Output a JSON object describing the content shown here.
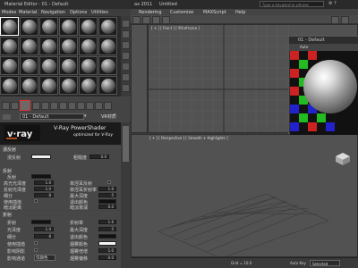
{
  "app": {
    "title_left": "ax 2011",
    "title_mid": "Untitled",
    "search_placeholder": "Type a keyword or phrase",
    "menu": [
      "Rendering",
      "Customize",
      "MAXScript",
      "Help"
    ]
  },
  "material_editor": {
    "title": "Material Editor - 01 - Default",
    "menu": [
      "Modes",
      "Material",
      "Navigation",
      "Options",
      "Utilities"
    ],
    "material_name": "01 - Default",
    "material_type": "VR材质",
    "vray_banner": {
      "logo": "v·ray",
      "title": "V-Ray PowerShader",
      "subtitle": "optimized for V-Ray"
    },
    "diffuse": {
      "header": "漫反射",
      "label": "漫反射",
      "roughness_label": "粗糙度",
      "roughness": "0.0"
    },
    "reflection": {
      "header": "反射",
      "reflect_label": "反射",
      "rows": [
        {
          "left": "高光光泽度",
          "lval": "1.0",
          "right": "菲涅耳反射",
          "rval": ""
        },
        {
          "left": "反射光泽度",
          "lval": "1.0",
          "right": "菲涅耳折射率",
          "rval": "1.6"
        },
        {
          "left": "细分",
          "lval": "8",
          "right": "最大深度",
          "rval": "5"
        },
        {
          "left": "使用插值",
          "lval": "",
          "right": "退出颜色",
          "rval": ""
        },
        {
          "left": "暗淡距离",
          "lval": "",
          "right": "暗淡衰减",
          "rval": "0.0"
        }
      ]
    },
    "refraction": {
      "header": "折射",
      "rows": [
        {
          "left": "折射",
          "lval": "",
          "right": "折射率",
          "rval": "1.6"
        },
        {
          "left": "光泽度",
          "lval": "1.0",
          "right": "最大深度",
          "rval": "5"
        },
        {
          "left": "细分",
          "lval": "8",
          "right": "退出颜色",
          "rval": ""
        },
        {
          "left": "使用插值",
          "lval": "",
          "right": "烟雾颜色",
          "rval": ""
        },
        {
          "left": "影响阴影",
          "lval": "",
          "right": "烟雾倍增",
          "rval": "1.0"
        },
        {
          "left": "影响通道",
          "lval": "仅颜色",
          "right": "烟雾偏移",
          "rval": "0.0"
        }
      ]
    }
  },
  "viewports": {
    "top_left": "[ + ] [ Front ] [ Wireframe ]",
    "perspective": "[ + ] [ Perspective ] [ Smooth + Highlights ]"
  },
  "preview": {
    "title": "01 - Default",
    "tool": "Auto"
  },
  "statusbar": {
    "grid": "Grid = 10.0",
    "autokey": "Auto Key",
    "selected": "Selected"
  },
  "colors": {
    "accent_red": "#e03030",
    "viewport_bg": "#525252"
  }
}
